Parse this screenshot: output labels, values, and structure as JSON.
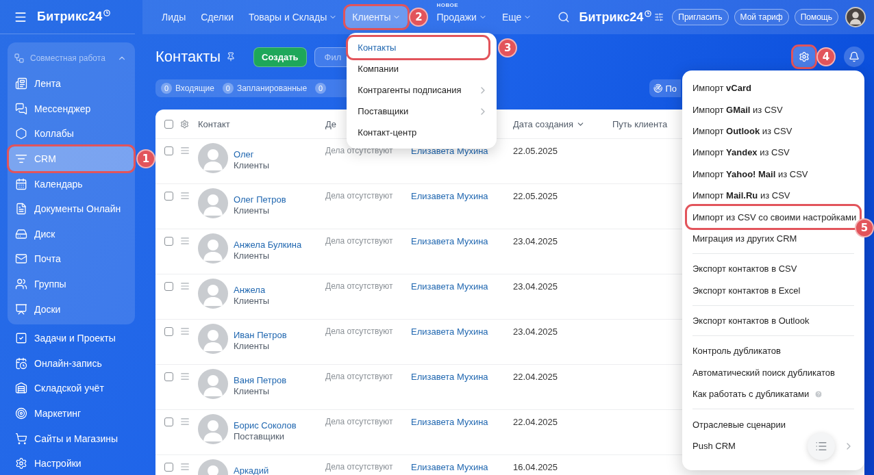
{
  "brand": {
    "name": "Битрикс24"
  },
  "top_nav": [
    {
      "label": "Лиды",
      "dropdown": false,
      "selected": false
    },
    {
      "label": "Сделки",
      "dropdown": false,
      "selected": false
    },
    {
      "label": "Товары и Склады",
      "dropdown": true,
      "selected": false
    },
    {
      "label": "Клиенты",
      "dropdown": true,
      "selected": true,
      "callout": "2"
    },
    {
      "label": "Продажи",
      "dropdown": true,
      "selected": false,
      "badge": "НОВОЕ"
    },
    {
      "label": "Еще",
      "dropdown": true,
      "selected": false
    }
  ],
  "header_right": {
    "brand": "Битрикс24",
    "buttons": [
      "Пригласить",
      "Мой тариф",
      "Помощь"
    ]
  },
  "clients_menu": {
    "items": [
      {
        "label": "Контакты",
        "selected": true,
        "submenu": false,
        "callout": "3"
      },
      {
        "label": "Компании",
        "selected": false,
        "submenu": false
      },
      {
        "label": "Контрагенты подписания",
        "selected": false,
        "submenu": true
      },
      {
        "label": "Поставщики",
        "selected": false,
        "submenu": true
      },
      {
        "label": "Контакт-центр",
        "selected": false,
        "submenu": false
      }
    ]
  },
  "sidebar": {
    "group": {
      "title": "Совместная работа",
      "expanded": true,
      "items": [
        {
          "label": "Лента",
          "selected": false
        },
        {
          "label": "Мессенджер",
          "selected": false
        },
        {
          "label": "Коллабы",
          "selected": false
        },
        {
          "label": "CRM",
          "selected": true,
          "callout": "1"
        },
        {
          "label": "Календарь",
          "selected": false
        },
        {
          "label": "Документы Онлайн",
          "selected": false
        },
        {
          "label": "Диск",
          "selected": false
        },
        {
          "label": "Почта",
          "selected": false
        },
        {
          "label": "Группы",
          "selected": false
        },
        {
          "label": "Доски",
          "selected": false
        }
      ]
    },
    "items": [
      {
        "label": "Задачи и Проекты",
        "selected": false
      },
      {
        "label": "Онлайн-запись",
        "selected": false
      },
      {
        "label": "Складской учёт",
        "selected": false
      },
      {
        "label": "Маркетинг",
        "selected": false
      },
      {
        "label": "Сайты и Магазины",
        "selected": false
      }
    ],
    "settings": "Настройки"
  },
  "page": {
    "title": "Контакты",
    "create_button": "Создать",
    "filter_button": "Фил",
    "settings_button": {
      "callout": "4"
    }
  },
  "counters": [
    {
      "count": "0",
      "label": "Входящие"
    },
    {
      "count": "0",
      "label": "Запланированные"
    },
    {
      "count": "0"
    }
  ],
  "counters_action": "По",
  "table": {
    "select_all": false,
    "columns": {
      "contact": "Контакт",
      "column_2": "Де",
      "date": {
        "label": "Дата создания",
        "sorted": true
      },
      "path": "Путь клиента"
    },
    "rows": [
      {
        "name": "Олег",
        "type": "Клиенты",
        "activity": "Дела отсутствуют",
        "responsible": "Елизавета Мухина",
        "date": "22.05.2025",
        "checked": false
      },
      {
        "name": "Олег Петров",
        "type": "Клиенты",
        "activity": "Дела отсутствуют",
        "responsible": "Елизавета Мухина",
        "date": "22.05.2025",
        "checked": false
      },
      {
        "name": "Анжела Булкина",
        "type": "Клиенты",
        "activity": "Дела отсутствуют",
        "responsible": "Елизавета Мухина",
        "date": "23.04.2025",
        "checked": false
      },
      {
        "name": "Анжела",
        "type": "Клиенты",
        "activity": "Дела отсутствуют",
        "responsible": "Елизавета Мухина",
        "date": "23.04.2025",
        "checked": false
      },
      {
        "name": "Иван Петров",
        "type": "Клиенты",
        "activity": "Дела отсутствуют",
        "responsible": "Елизавета Мухина",
        "date": "23.04.2025",
        "checked": false
      },
      {
        "name": "Ваня Петров",
        "type": "Клиенты",
        "activity": "Дела отсутствуют",
        "responsible": "Елизавета Мухина",
        "date": "22.04.2025",
        "checked": false
      },
      {
        "name": "Борис Соколов",
        "type": "Поставщики",
        "activity": "Дела отсутствуют",
        "responsible": "Елизавета Мухина",
        "date": "22.04.2025",
        "checked": false
      },
      {
        "name": "Аркадий",
        "activity": "Дела отсутствуют",
        "responsible": "Елизавета Мухина",
        "date": "16.04.2025",
        "checked": false
      }
    ]
  },
  "settings_menu": {
    "sections": [
      {
        "items": [
          {
            "label": "Импорт **vCard**",
            "kind": "plain"
          },
          {
            "label": "Импорт **GMail** из CSV",
            "kind": "plain"
          },
          {
            "label": "Импорт **Outlook** из CSV",
            "kind": "plain"
          },
          {
            "label": "Импорт **Yandex** из CSV",
            "kind": "plain"
          },
          {
            "label": "Импорт **Yahoo! Mail** из CSV",
            "kind": "plain"
          },
          {
            "label": "Импорт **Mail.Ru** из CSV",
            "kind": "plain"
          },
          {
            "label": "Импорт из CSV со своими настройками",
            "kind": "plain",
            "callout": "5"
          },
          {
            "label": "Миграция из других CRM",
            "kind": "plain"
          }
        ]
      },
      {
        "items": [
          {
            "label": "Экспорт контактов в CSV",
            "kind": "plain"
          },
          {
            "label": "Экспорт контактов в Excel",
            "kind": "plain"
          }
        ]
      },
      {
        "items": [
          {
            "label": "Экспорт контактов в Outlook",
            "kind": "plain"
          }
        ]
      },
      {
        "items": [
          {
            "label": "Контроль дубликатов",
            "kind": "plain"
          },
          {
            "label": "Автоматический поиск дубликатов",
            "kind": "plain"
          },
          {
            "label": "Как работать с дубликатами",
            "kind": "help"
          }
        ]
      },
      {
        "items": [
          {
            "label": "Отраслевые сценарии",
            "kind": "plain"
          },
          {
            "label": "Push CRM",
            "kind": "submenu"
          }
        ]
      }
    ]
  }
}
